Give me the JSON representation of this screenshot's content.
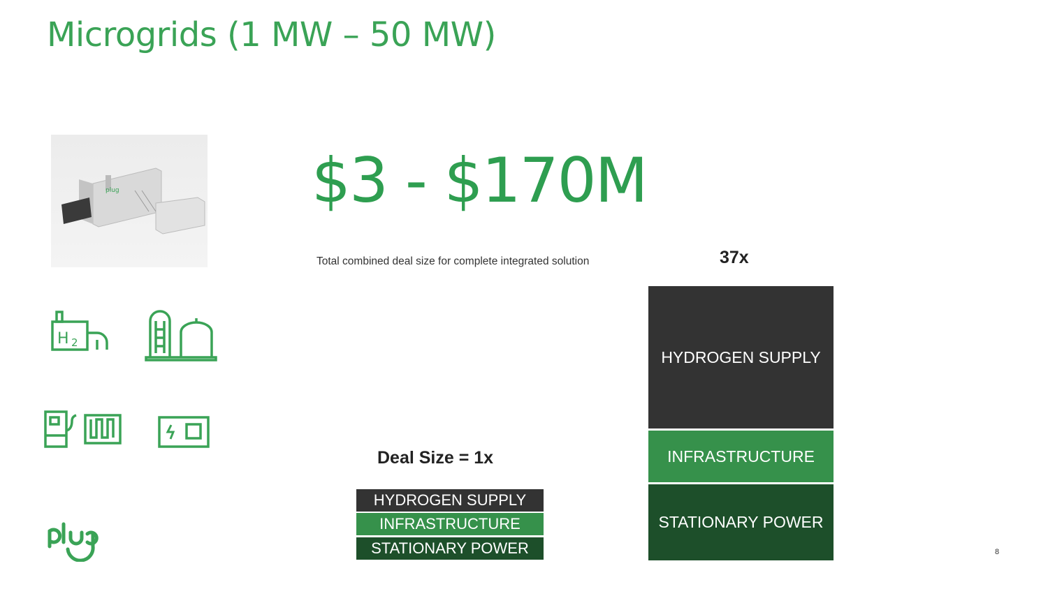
{
  "title": "Microgrids (1 MW – 50 MW)",
  "headline": "$3 - $170M",
  "caption": "Total combined deal size for complete integrated solution",
  "small_stack": {
    "label": "Deal Size = 1x",
    "segments": [
      "HYDROGEN SUPPLY",
      "INFRASTRUCTURE",
      "STATIONARY POWER"
    ]
  },
  "big_stack": {
    "label": "37x",
    "segments": [
      "HYDROGEN SUPPLY",
      "INFRASTRUCTURE",
      "STATIONARY POWER"
    ]
  },
  "icons": [
    "h2-plant-icon",
    "storage-tank-icon",
    "fuel-cell-icon",
    "battery-icon"
  ],
  "logo_text": "plug",
  "page_number": "8",
  "colors": {
    "brand_green": "#3aa356",
    "dark_segment": "#333333",
    "mid_segment": "#36914b",
    "deep_segment": "#1d4f2a"
  }
}
